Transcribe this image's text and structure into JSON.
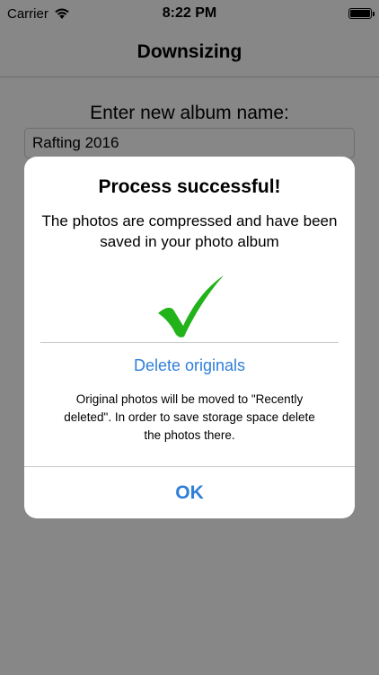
{
  "status_bar": {
    "carrier": "Carrier",
    "time": "8:22 PM",
    "battery_level": 1.0
  },
  "nav": {
    "title": "Downsizing"
  },
  "form": {
    "album_label": "Enter new album name:",
    "album_value": "Rafting 2016"
  },
  "alert": {
    "title": "Process successful!",
    "message": "The photos are compressed and have been saved in your photo album",
    "icon": "checkmark-icon",
    "icon_color": "#22b21a",
    "delete_label": "Delete originals",
    "info": "Original photos will be moved to \"Recently deleted\". In order to save storage space delete the photos there.",
    "ok_label": "OK"
  },
  "colors": {
    "accent": "#2f7fd8",
    "overlay": "rgba(0,0,0,0.47)"
  }
}
